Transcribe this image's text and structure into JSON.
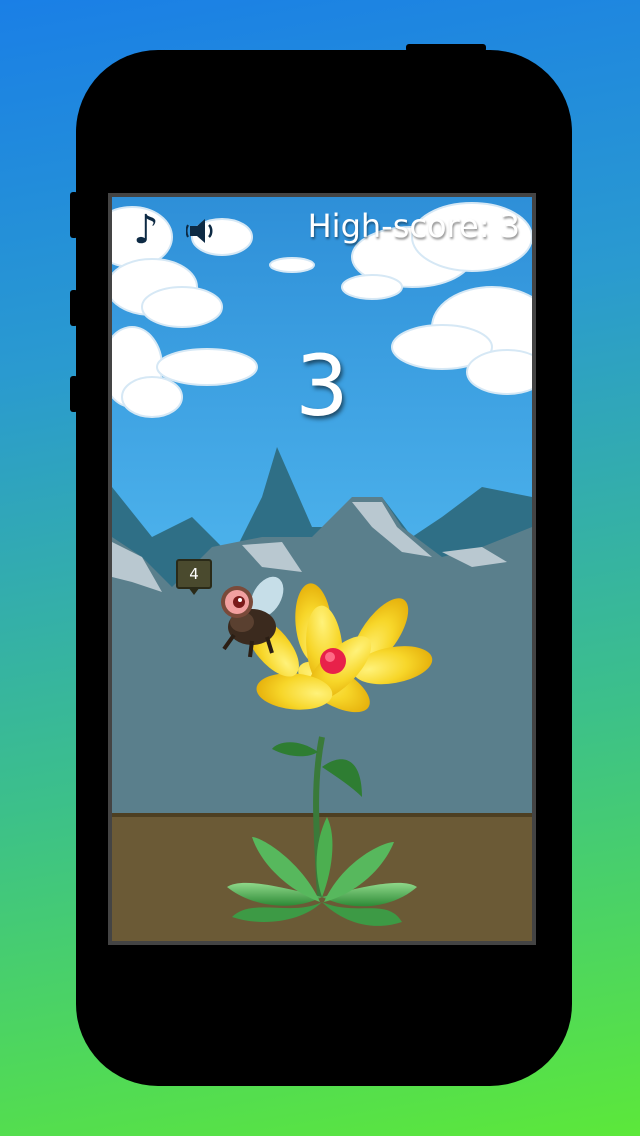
{
  "game": {
    "score": "3",
    "high_score_text": "High-score: 3",
    "fly_counter": "4"
  },
  "hud": {
    "music_icon": "music-note-icon",
    "sound_icon": "speaker-muted-icon"
  },
  "colors": {
    "sky": "#3aa8e8",
    "mountain": "#2f6f86",
    "ground": "#6b5a36",
    "petal": "#f7d629",
    "flower_center": "#e8214a"
  }
}
